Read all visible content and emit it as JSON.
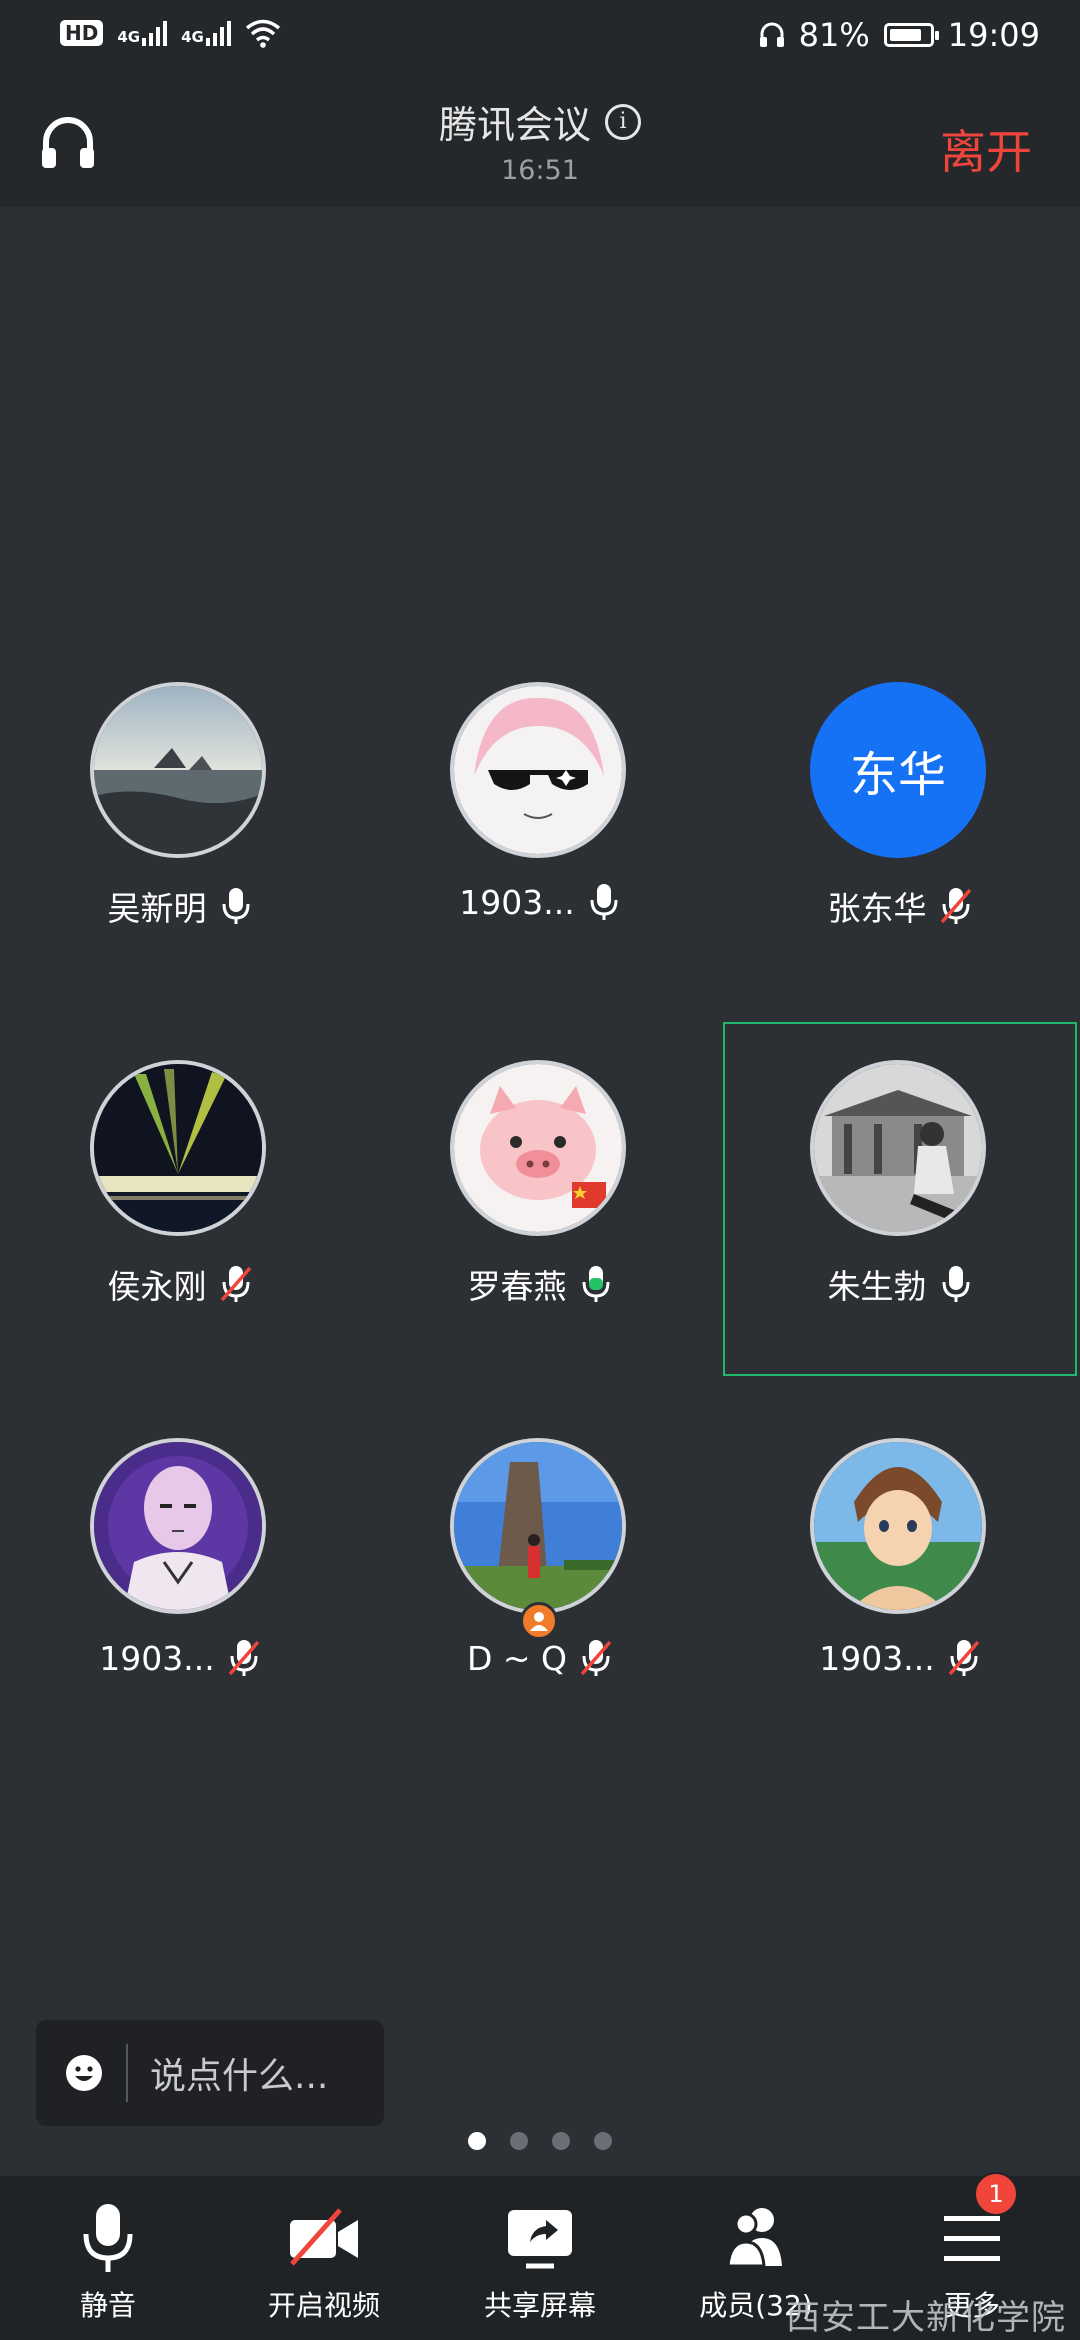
{
  "status_bar": {
    "hd": "HD",
    "net1": "4G",
    "net2": "4G",
    "battery": "81%",
    "battery_fraction": 0.81,
    "time": "19:09"
  },
  "header": {
    "title": "腾讯会议",
    "timer": "16:51",
    "leave_label": "离开"
  },
  "participants": [
    {
      "name": "吴新明",
      "mic": "on"
    },
    {
      "name": "1903...",
      "mic": "on"
    },
    {
      "name": "张东华",
      "mic": "muted",
      "avatar_text": "东华"
    },
    {
      "name": "侯永刚",
      "mic": "muted"
    },
    {
      "name": "罗春燕",
      "mic": "speaking"
    },
    {
      "name": "朱生勃",
      "mic": "on",
      "selected": true
    },
    {
      "name": "1903...",
      "mic": "muted"
    },
    {
      "name": "D ~ Q",
      "mic": "muted",
      "sharing": true
    },
    {
      "name": "1903...",
      "mic": "muted"
    }
  ],
  "chat": {
    "placeholder": "说点什么..."
  },
  "pager": {
    "count": 4,
    "active": 1
  },
  "toolbar": {
    "mute_label": "静音",
    "video_label": "开启视频",
    "share_label": "共享屏幕",
    "members_label": "成员(32)",
    "more_label": "更多",
    "more_badge": "1"
  },
  "watermark": "西安工大新化学院",
  "colors": {
    "accent_red": "#f0453a",
    "avatar_blue": "#1672f4",
    "selected_green": "#1fb86a",
    "speaking_green": "#23c267"
  }
}
